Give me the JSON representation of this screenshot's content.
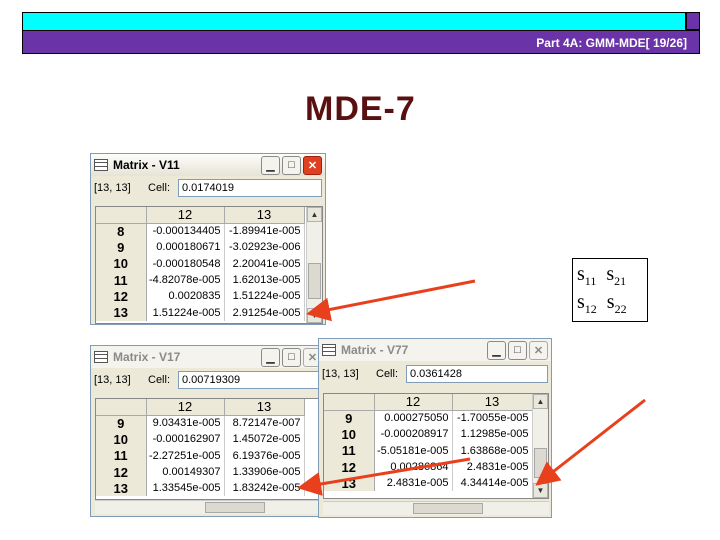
{
  "header": {
    "text": "Part 4A: GMM-MDE[ 19/26]"
  },
  "slide_title": "MDE-7",
  "legend": {
    "s11": "s",
    "s11_sub": "11",
    "s21": "s",
    "s21_sub": "21",
    "s12": "s",
    "s12_sub": "12",
    "s22": "s",
    "s22_sub": "22"
  },
  "windows": {
    "v11": {
      "title": "Matrix - V11",
      "pos": "[13, 13]",
      "cell_label": "Cell:",
      "cell_value": "0.0174019",
      "cols": [
        "12",
        "13"
      ],
      "rows": [
        {
          "h": "8",
          "a": "-0.000134405",
          "b": "-1.89941e-005"
        },
        {
          "h": "9",
          "a": "0.000180671",
          "b": "-3.02923e-006"
        },
        {
          "h": "10",
          "a": "-0.000180548",
          "b": "2.20041e-005"
        },
        {
          "h": "11",
          "a": "-4.82078e-005",
          "b": "1.62013e-005"
        },
        {
          "h": "12",
          "a": "0.0020835",
          "b": "1.51224e-005"
        },
        {
          "h": "13",
          "a": "1.51224e-005",
          "b": "2.91254e-005"
        }
      ]
    },
    "v17": {
      "title": "Matrix - V17",
      "pos": "[13, 13]",
      "cell_label": "Cell:",
      "cell_value": "0.00719309",
      "cols": [
        "12",
        "13"
      ],
      "rows": [
        {
          "h": "9",
          "a": "9.03431e-005",
          "b": "8.72147e-007"
        },
        {
          "h": "10",
          "a": "-0.000162907",
          "b": "1.45072e-005"
        },
        {
          "h": "11",
          "a": "-2.27251e-005",
          "b": "6.19376e-005"
        },
        {
          "h": "12",
          "a": "0.00149307",
          "b": "1.33906e-005"
        },
        {
          "h": "13",
          "a": "1.33545e-005",
          "b": "1.83242e-005"
        }
      ]
    },
    "v77": {
      "title": "Matrix - V77",
      "pos": "[13, 13]",
      "cell_label": "Cell:",
      "cell_value": "0.0361428",
      "cols": [
        "12",
        "13"
      ],
      "rows": [
        {
          "h": "9",
          "a": "0.000275050",
          "b": "-1.70055e-005"
        },
        {
          "h": "10",
          "a": "-0.000208917",
          "b": "1.12985e-005"
        },
        {
          "h": "11",
          "a": "-5.05181e-005",
          "b": "1.63868e-005"
        },
        {
          "h": "12",
          "a": "0.00286864",
          "b": "2.4831e-005"
        },
        {
          "h": "13",
          "a": "2.4831e-005",
          "b": "4.34414e-005"
        }
      ]
    }
  },
  "colors": {
    "header_cyan": "#00ffff",
    "header_purple": "#6b33a8",
    "title": "#5a1010",
    "arrow": "#e8401c"
  }
}
